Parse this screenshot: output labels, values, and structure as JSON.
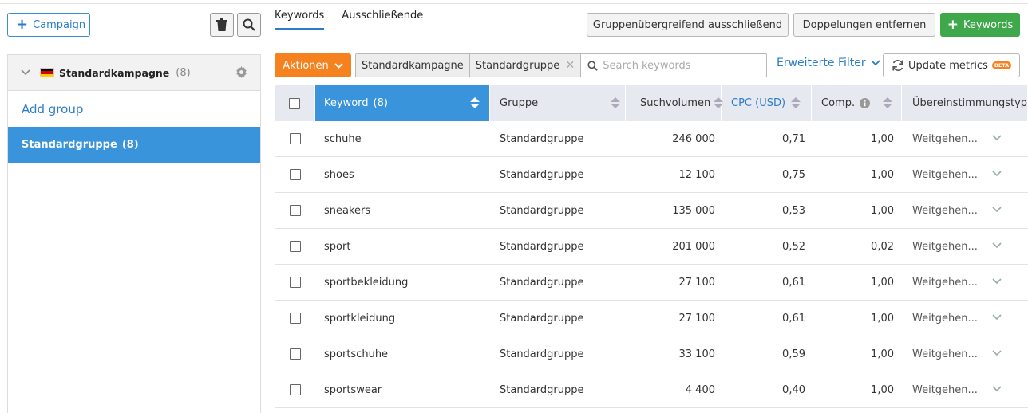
{
  "sidebar": {
    "add_campaign_label": "Campaign",
    "campaign": {
      "name": "Standardkampagne",
      "count": "(8)"
    },
    "add_group_label": "Add group",
    "groups": [
      {
        "label": "Standardgruppe",
        "count": "(8)"
      }
    ]
  },
  "tabs": [
    {
      "label": "Keywords",
      "active": true
    },
    {
      "label": "Ausschließende",
      "active": false
    }
  ],
  "toolbar": {
    "cross_group_label": "Gruppenübergreifend ausschließend",
    "remove_duplicates_label": "Doppelungen entfernen",
    "add_keywords_label": "Keywords",
    "actions_label": "Aktionen",
    "filter_chips": [
      "Standardkampagne",
      "Standardgruppe"
    ],
    "search_placeholder": "Search keywords",
    "advanced_filter_label": "Erweiterte Filter",
    "update_metrics_label": "Update metrics",
    "beta_badge": "BETA"
  },
  "table": {
    "headers": {
      "keyword": "Keyword",
      "keyword_count": "(8)",
      "group": "Gruppe",
      "volume": "Suchvolumen",
      "cpc": "CPC (USD)",
      "comp": "Comp.",
      "match": "Übereinstimmungstyp"
    },
    "rows": [
      {
        "keyword": "schuhe",
        "group": "Standardgruppe",
        "volume": "246 000",
        "cpc": "0,71",
        "comp": "1,00",
        "match": "Weitgehen..."
      },
      {
        "keyword": "shoes",
        "group": "Standardgruppe",
        "volume": "12 100",
        "cpc": "0,75",
        "comp": "1,00",
        "match": "Weitgehen..."
      },
      {
        "keyword": "sneakers",
        "group": "Standardgruppe",
        "volume": "135 000",
        "cpc": "0,53",
        "comp": "1,00",
        "match": "Weitgehen..."
      },
      {
        "keyword": "sport",
        "group": "Standardgruppe",
        "volume": "201 000",
        "cpc": "0,52",
        "comp": "0,02",
        "match": "Weitgehen..."
      },
      {
        "keyword": "sportbekleidung",
        "group": "Standardgruppe",
        "volume": "27 100",
        "cpc": "0,61",
        "comp": "1,00",
        "match": "Weitgehen..."
      },
      {
        "keyword": "sportkleidung",
        "group": "Standardgruppe",
        "volume": "27 100",
        "cpc": "0,61",
        "comp": "1,00",
        "match": "Weitgehen..."
      },
      {
        "keyword": "sportschuhe",
        "group": "Standardgruppe",
        "volume": "33 100",
        "cpc": "0,59",
        "comp": "1,00",
        "match": "Weitgehen..."
      },
      {
        "keyword": "sportswear",
        "group": "Standardgruppe",
        "volume": "4 400",
        "cpc": "0,40",
        "comp": "1,00",
        "match": "Weitgehen..."
      }
    ]
  },
  "colors": {
    "primary_blue": "#3a94dc",
    "link_blue": "#2b7cc9",
    "action_orange": "#f5811f",
    "add_green": "#3fa84a"
  },
  "icons": [
    "plus-icon",
    "trash-icon",
    "search-icon",
    "chevron-down-icon",
    "germany-flag-icon",
    "gear-icon",
    "refresh-icon",
    "sort-icon",
    "info-icon",
    "close-icon"
  ]
}
